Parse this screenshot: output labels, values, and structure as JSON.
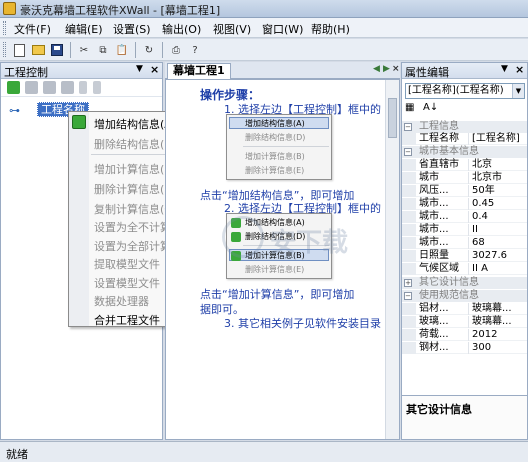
{
  "window": {
    "title": "豪沃克幕墙工程软件XWall - [幕墙工程1]"
  },
  "menu": [
    "文件(F)",
    "编辑(E)",
    "设置(S)",
    "输出(O)",
    "视图(V)",
    "窗口(W)",
    "帮助(H)"
  ],
  "toolbar": {
    "icons": [
      "new-icon",
      "open-icon",
      "save-icon",
      "cut-icon",
      "copy-icon",
      "paste-icon",
      "refresh-icon",
      "print-icon",
      "help-icon"
    ]
  },
  "left_pane": {
    "title": "工程控制",
    "tree_root": "工程名称"
  },
  "context_menu": {
    "items": [
      {
        "label": "增加结构信息(A)",
        "enabled": true
      },
      {
        "label": "删除结构信息(D)",
        "enabled": false
      },
      {
        "label": "增加计算信息(B)",
        "enabled": false
      },
      {
        "label": "删除计算信息(E)",
        "enabled": false
      },
      {
        "label": "复制计算信息(C)",
        "enabled": false
      },
      {
        "label": "设置为全不计算",
        "enabled": false
      },
      {
        "label": "设置为全部计算",
        "enabled": false
      },
      {
        "label": "提取模型文件",
        "enabled": false
      },
      {
        "label": "设置模型文件",
        "enabled": false
      },
      {
        "label": "数据处理器",
        "enabled": false
      },
      {
        "label": "合并工程文件",
        "enabled": true
      }
    ]
  },
  "doc": {
    "tab": "幕墙工程1",
    "heading": "操作步骤：",
    "step1": "1.   选择左边【工程控制】框中的",
    "mini1": [
      "增加结构信息(A)",
      "删除结构信息(D)",
      "增加计算信息(B)",
      "删除计算信息(E)"
    ],
    "line2": "点击“增加结构信息”，即可增加",
    "step2": "2.   选择左边【工程控制】框中的",
    "mini2": [
      "增加结构信息(A)",
      "删除结构信息(D)",
      "增加计算信息(B)",
      "删除计算信息(E)"
    ],
    "line3": "点击“增加计算信息”，即可增加",
    "line4": "据即可。",
    "step3": "3.   其它相关例子见软件安装目录"
  },
  "right_pane": {
    "title": "属性编辑",
    "select_value": "[工程名称](工程名称)",
    "categories": [
      {
        "name": "工程信息",
        "rows": [
          {
            "k": "工程名称",
            "v": "[工程名称]"
          }
        ]
      },
      {
        "name": "城市基本信息",
        "rows": [
          {
            "k": "省直辖市",
            "v": "北京"
          },
          {
            "k": "城市",
            "v": "北京市"
          },
          {
            "k": "风压...",
            "v": "50年"
          },
          {
            "k": "城市...",
            "v": "0.45"
          },
          {
            "k": "城市...",
            "v": "0.4"
          },
          {
            "k": "城市...",
            "v": "II"
          },
          {
            "k": "城市...",
            "v": "68"
          },
          {
            "k": "日照量",
            "v": "3027.6"
          },
          {
            "k": "气候区域",
            "v": "II A"
          }
        ]
      },
      {
        "name": "其它设计信息",
        "rows": []
      },
      {
        "name": "使用规范信息",
        "rows": [
          {
            "k": "铝材...",
            "v": "玻璃幕..."
          },
          {
            "k": "玻璃...",
            "v": "玻璃幕..."
          },
          {
            "k": "荷载...",
            "v": "2012"
          },
          {
            "k": "钢材...",
            "v": "300"
          }
        ]
      }
    ],
    "description_title": "其它设计信息"
  },
  "status": {
    "text": "就绪"
  },
  "watermark": "安下载"
}
